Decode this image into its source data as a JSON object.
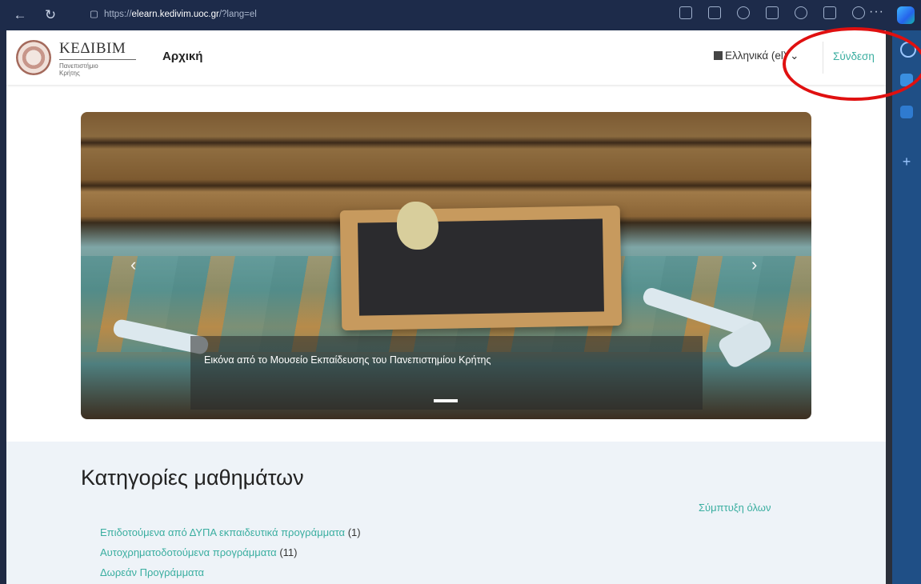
{
  "browser": {
    "url_prefix": "https://",
    "url_host": "elearn.kedivim.uoc.gr",
    "url_suffix": "/?lang=el",
    "more_label": "···"
  },
  "header": {
    "logo_title": "ΚΕΔΙΒΙΜ",
    "logo_sub_line1": "Πανεπιστήμιο",
    "logo_sub_line2": "Κρήτης",
    "home_link": "Αρχική",
    "language": "Ελληνικά (el)",
    "login": "Σύνδεση"
  },
  "hero": {
    "caption": "Εικόνα από το Μουσείο Εκπαίδευσης του Πανεπιστημίου Κρήτης"
  },
  "courses": {
    "heading": "Κατηγορίες μαθημάτων",
    "collapse_all": "Σύμπτυξη όλων",
    "categories": [
      {
        "name": "Επιδοτούμενα από ΔΥΠΑ εκπαιδευτικά προγράμματα",
        "count": "(1)"
      },
      {
        "name": "Αυτοχρηματοδοτούμενα προγράμματα",
        "count": "(11)"
      },
      {
        "name": "Δωρεάν Προγράμματα",
        "count": ""
      }
    ]
  },
  "colors": {
    "accent": "#3aaea0",
    "annotation": "#e01010",
    "browser_chrome": "#1d2b4a"
  }
}
